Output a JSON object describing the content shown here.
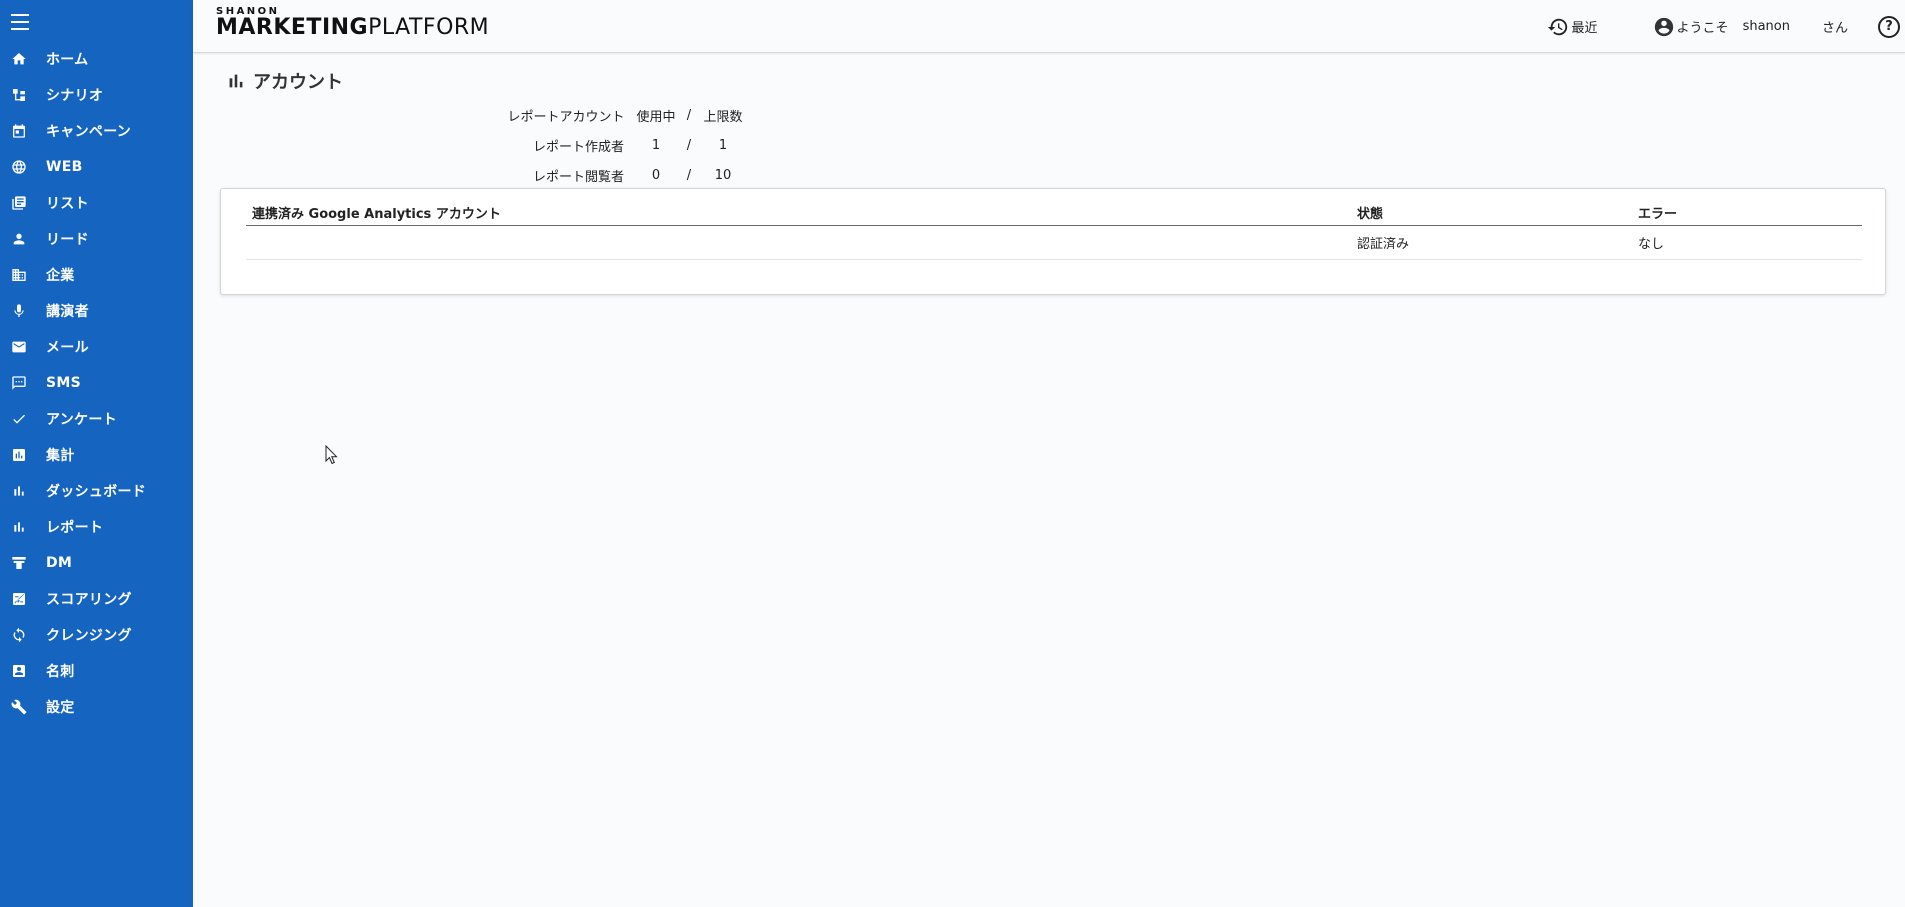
{
  "sidebar": {
    "items": [
      {
        "label": "ホーム",
        "icon": "home-icon"
      },
      {
        "label": "シナリオ",
        "icon": "scenario-icon"
      },
      {
        "label": "キャンペーン",
        "icon": "calendar-icon"
      },
      {
        "label": "WEB",
        "icon": "globe-icon"
      },
      {
        "label": "リスト",
        "icon": "list-icon"
      },
      {
        "label": "リード",
        "icon": "person-icon"
      },
      {
        "label": "企業",
        "icon": "building-icon"
      },
      {
        "label": "講演者",
        "icon": "microphone-icon"
      },
      {
        "label": "メール",
        "icon": "mail-icon"
      },
      {
        "label": "SMS",
        "icon": "sms-icon"
      },
      {
        "label": "アンケート",
        "icon": "check-icon"
      },
      {
        "label": "集計",
        "icon": "chart-box-icon"
      },
      {
        "label": "ダッシュボード",
        "icon": "bar-chart-icon"
      },
      {
        "label": "レポート",
        "icon": "bar-chart-icon"
      },
      {
        "label": "DM",
        "icon": "print-icon"
      },
      {
        "label": "スコアリング",
        "icon": "scoring-icon"
      },
      {
        "label": "クレンジング",
        "icon": "sync-icon"
      },
      {
        "label": "名刺",
        "icon": "card-icon"
      },
      {
        "label": "設定",
        "icon": "wrench-icon"
      }
    ]
  },
  "header": {
    "brand": "SHANON",
    "product_bold": "MARKETING",
    "product_thin": "PLATFORM",
    "recent_label": "最近",
    "welcome": "ようこそ",
    "username": "shanon",
    "honorific": "さん",
    "help": "?"
  },
  "page": {
    "title": "アカウント"
  },
  "usage": {
    "header": [
      "レポートアカウント",
      "使用中",
      "/",
      "上限数"
    ],
    "rows": [
      [
        "レポート作成者",
        "1",
        "/",
        "1"
      ],
      [
        "レポート閲覧者",
        "0",
        "/",
        "10"
      ]
    ]
  },
  "ga_table": {
    "headers": [
      "連携済み Google Analytics アカウント",
      "状態",
      "エラー"
    ],
    "rows": [
      [
        "",
        "認証済み",
        "なし"
      ]
    ]
  }
}
